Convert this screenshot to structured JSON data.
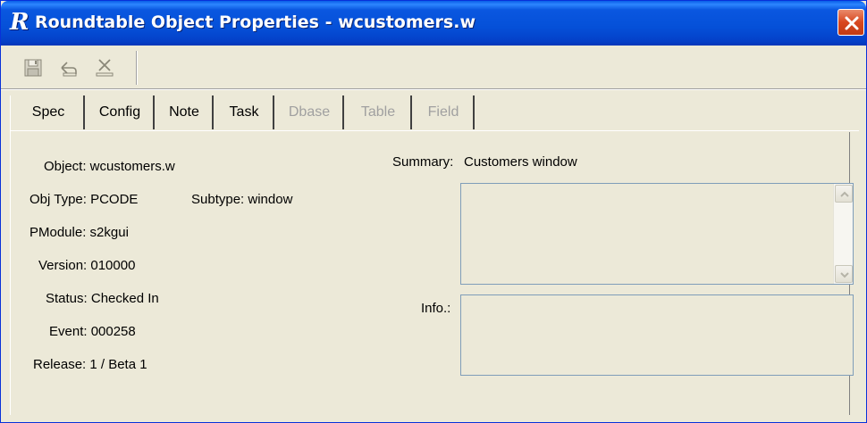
{
  "window": {
    "title": "Roundtable Object Properties - wcustomers.w",
    "logo_letter": "R",
    "close_icon": "close-icon"
  },
  "toolbar": {
    "buttons": [
      {
        "name": "save-icon",
        "enabled": false
      },
      {
        "name": "undo-icon",
        "enabled": false
      },
      {
        "name": "delete-icon",
        "enabled": false
      }
    ]
  },
  "tabs": [
    {
      "label": "Spec",
      "active": true,
      "enabled": true
    },
    {
      "label": "Config",
      "active": false,
      "enabled": true
    },
    {
      "label": "Note",
      "active": false,
      "enabled": true
    },
    {
      "label": "Task",
      "active": false,
      "enabled": true
    },
    {
      "label": "Dbase",
      "active": false,
      "enabled": false
    },
    {
      "label": "Table",
      "active": false,
      "enabled": false
    },
    {
      "label": "Field",
      "active": false,
      "enabled": false
    }
  ],
  "spec": {
    "object": "Object: wcustomers.w",
    "obj_type": "Obj Type: PCODE",
    "subtype": "Subtype: window",
    "pmodule": "PModule: s2kgui",
    "version": "Version: 010000",
    "status": "Status: Checked In",
    "event": "Event: 000258",
    "release": "Release: 1 / Beta 1",
    "summary_label": "Summary:",
    "summary_value": "Customers window",
    "info_label": "Info.:",
    "summary_text": "",
    "info_text": ""
  },
  "colors": {
    "title_bar": "#0550d8",
    "dialog_bg": "#ece9d8",
    "close_button": "#d8471f",
    "disabled_text": "#a0a0a0"
  }
}
